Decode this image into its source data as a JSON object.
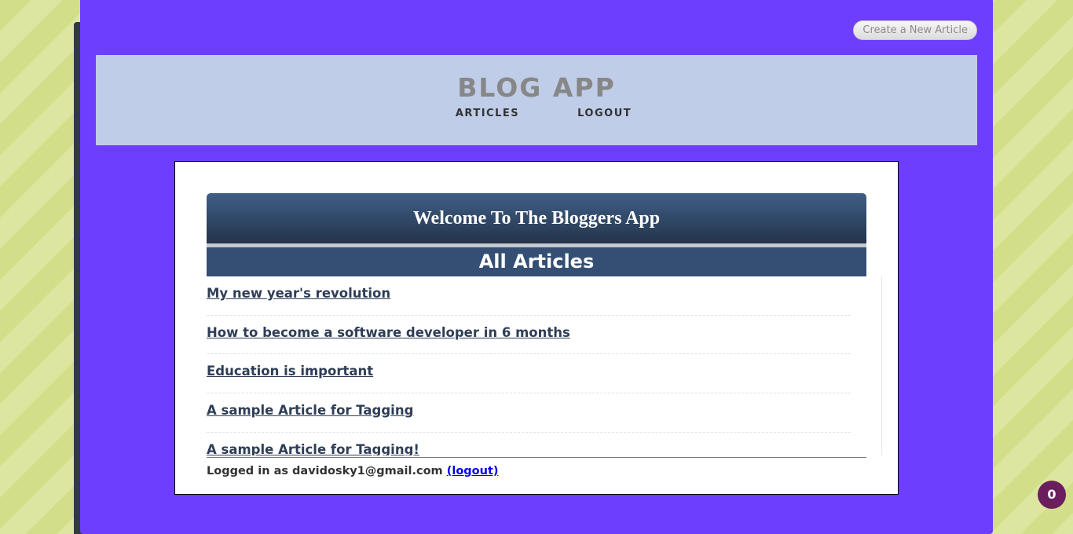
{
  "header": {
    "create_label": "Create a New Article",
    "brand": "BLOG APP",
    "nav": {
      "articles": "ARTICLES",
      "logout": "LOGOUT"
    }
  },
  "main": {
    "welcome": "Welcome To The Bloggers App",
    "section_title": "All Articles",
    "articles": [
      "My new year's revolution",
      "How to become a software developer in 6 months",
      "Education is important",
      "A sample Article for Tagging",
      "A sample Article for Tagging!"
    ],
    "logged_in_text": "Logged in as davidosky1@gmail.com",
    "logout_link": "(logout)"
  },
  "badge": {
    "count": "0"
  }
}
